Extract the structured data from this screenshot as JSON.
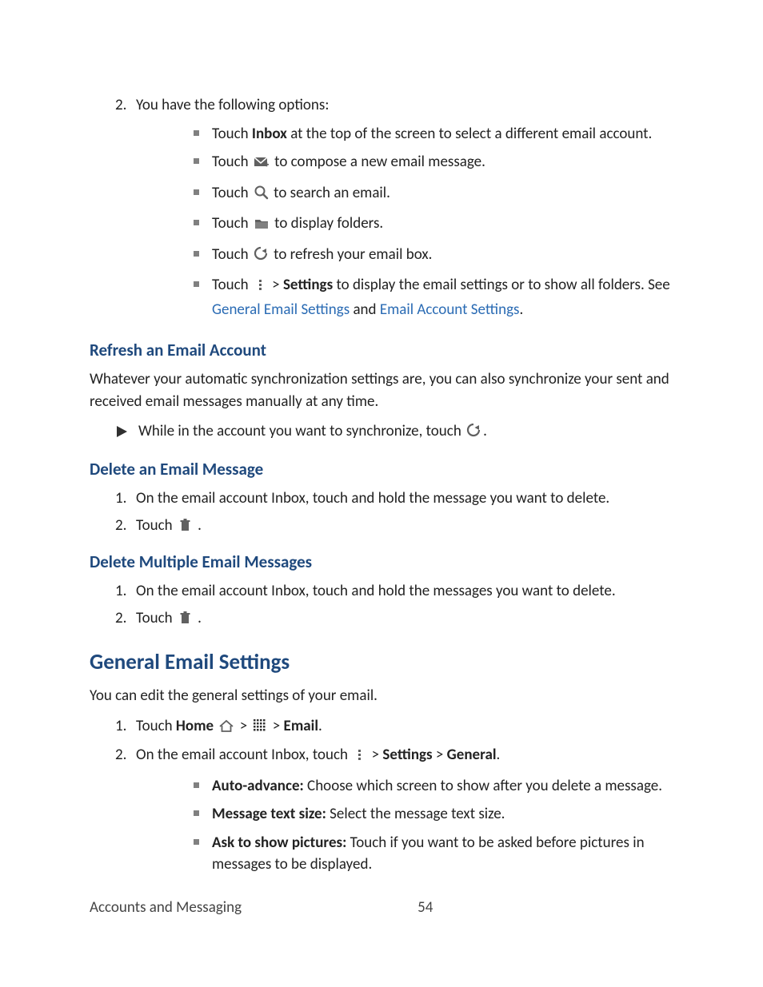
{
  "step2_lead": "You have the following options:",
  "bullets_top": [
    {
      "pre": "Touch ",
      "bold": "Inbox",
      "post": " at the top of the screen to select a different email account."
    },
    {
      "pre": "Touch ",
      "icon": "compose",
      "post": " to compose a new email message."
    },
    {
      "pre": "Touch ",
      "icon": "search",
      "post": " to search an email."
    },
    {
      "pre": "Touch ",
      "icon": "folder",
      "post": " to display folders."
    },
    {
      "pre": "Touch ",
      "icon": "refresh",
      "post": " to refresh your email box."
    }
  ],
  "settings_bullet": {
    "pre": "Touch ",
    "sep": " > ",
    "bold": "Settings",
    "post": " to display the email settings or to show all folders. See ",
    "link1": "General Email Settings",
    "and": " and ",
    "link2": "Email Account Settings",
    "end": "."
  },
  "h_refresh": "Refresh an Email Account",
  "p_refresh": "Whatever your automatic synchronization settings are, you can also synchronize your sent and received email messages manually at any time.",
  "arrow_sync_pre": "While in the account you want to synchronize, touch ",
  "arrow_sync_post": ".",
  "h_delete_one": "Delete an Email Message",
  "delete_one_s1": "On the email account Inbox, touch and hold the message you want to delete.",
  "delete_touch_pre": "Touch ",
  "delete_touch_post": " .",
  "h_delete_multi": "Delete Multiple Email Messages",
  "delete_multi_s1": "On the email account Inbox, touch and hold the messages you want to delete.",
  "h_general": "General Email Settings",
  "p_general": "You can edit the general settings of your email.",
  "gen_s1_a": "Touch ",
  "gen_s1_home": "Home",
  "gen_s1_gt1": " > ",
  "gen_s1_gt2": " > ",
  "gen_s1_email": "Email",
  "gen_s1_end": ".",
  "gen_s2_a": "On the email account Inbox, touch ",
  "gen_s2_gt1": " > ",
  "gen_s2_settings": "Settings",
  "gen_s2_gt2": " > ",
  "gen_s2_general": "General",
  "gen_s2_end": ".",
  "gen_bullets": [
    {
      "bold": "Auto-advance:",
      "text": " Choose which screen to show after you delete a message."
    },
    {
      "bold": "Message text size:",
      "text": " Select the message text size."
    },
    {
      "bold": "Ask to show pictures:",
      "text": " Touch if you want to be asked before pictures in messages to be displayed."
    }
  ],
  "footer_title": "Accounts and Messaging",
  "footer_page": "54",
  "num": {
    "n1": "1.",
    "n2": "2."
  }
}
